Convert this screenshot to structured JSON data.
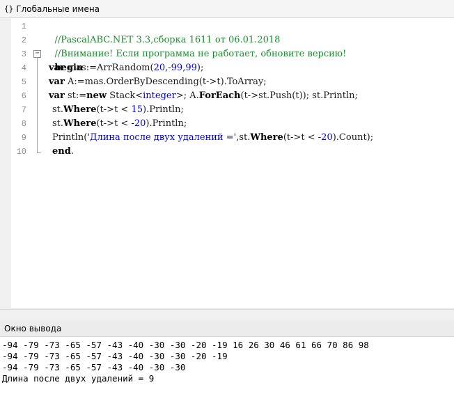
{
  "panel": {
    "icon": "{}",
    "title": "Глобальные имена"
  },
  "editor": {
    "line_numbers": [
      "1",
      "2",
      "3",
      "4",
      "5",
      "6",
      "7",
      "8",
      "9",
      "10"
    ],
    "lines": {
      "l1": {
        "comment": "//PascalABC.NET 3.3,сборка 1611 от 06.01.2018"
      },
      "l2": {
        "comment": "//Внимание! Если программа не работает, обновите версию!"
      },
      "l3": {
        "kw_begin": "begin"
      },
      "l4": {
        "kw_var": "var",
        "t1": " mas:=ArrRandom(",
        "n1": "20",
        "t2": ",",
        "n2": "-99",
        "t3": ",",
        "n3": "99",
        "t4": ");"
      },
      "l5": {
        "kw_var": "var",
        "t1": " A:=mas.OrderByDescending(t->t).ToArray;"
      },
      "l6": {
        "kw_var": "var",
        "t1": " st:=",
        "kw_new": "new",
        "t2": " Stack<",
        "typ": "integer",
        "t3": ">; A.",
        "kw_foreach": "ForEach",
        "t4": "(t->st.Push(t)); st.Println;"
      },
      "l7": {
        "t1": "st.",
        "kw_where": "Where",
        "t2": "(t->t < ",
        "n1": "15",
        "t3": ").Println;"
      },
      "l8": {
        "t1": "st.",
        "kw_where": "Where",
        "t2": "(t->t < ",
        "n1": "-20",
        "t3": ").Println;"
      },
      "l9": {
        "t1": "Println(",
        "str": "'Длина после двух удалений ='",
        "t2": ",st.",
        "kw_where": "Where",
        "t3": "(t->t < ",
        "n1": "-20",
        "t4": ").Count);"
      },
      "l10": {
        "kw_end": "end",
        "t1": "."
      }
    }
  },
  "output": {
    "title": "Окно вывода",
    "lines": [
      "-94 -79 -73 -65 -57 -43 -40 -30 -30 -20 -19 16 26 30 46 61 66 70 86 98",
      "-94 -79 -73 -65 -57 -43 -40 -30 -30 -20 -19",
      "-94 -79 -73 -65 -57 -43 -40 -30 -30",
      "Длина после двух удалений = 9"
    ]
  },
  "colors": {
    "comment": "#1f8a30",
    "number": "#0000c8",
    "string": "#0000c8",
    "keyword": "#000000"
  }
}
